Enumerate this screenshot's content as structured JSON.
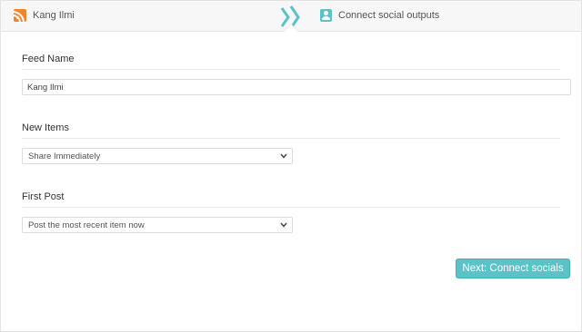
{
  "steps": {
    "feed": {
      "label": "Kang Ilmi",
      "icon": "rss-icon",
      "color": "#f4842b"
    },
    "separator": {
      "icon": "double-chevron-right-icon",
      "color": "#5bc2c8"
    },
    "social": {
      "label": "Connect social outputs",
      "icon": "user-icon",
      "color": "#5bc2c8"
    }
  },
  "form": {
    "feed_name": {
      "label": "Feed Name",
      "value": "Kang Ilmi"
    },
    "new_items": {
      "label": "New Items",
      "selected": "Share Immediately"
    },
    "first_post": {
      "label": "First Post",
      "selected": "Post the most recent item now"
    }
  },
  "actions": {
    "next_label": "Next: Connect socials",
    "accent_color": "#5bc2c8"
  }
}
